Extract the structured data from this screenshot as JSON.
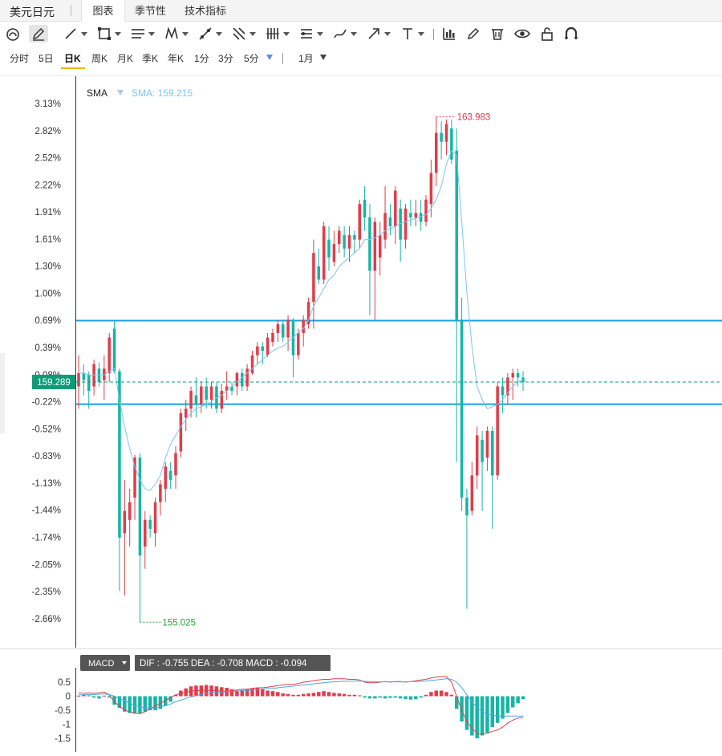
{
  "topbar": {
    "symbol": "美元日元",
    "tabs": [
      {
        "label": "图表",
        "active": true
      },
      {
        "label": "季节性",
        "active": false
      },
      {
        "label": "技术指标",
        "active": false
      }
    ]
  },
  "toolbar": {
    "tools": [
      "magnet-icon",
      "pencil-icon",
      "line-icon",
      "rect-icon",
      "horizontal-lines-icon",
      "pattern-icon",
      "ruler-icon",
      "fork-icon",
      "bars-icon",
      "level-lines-icon",
      "brush-icon",
      "arrow-icon",
      "text-icon",
      "chart-icon",
      "edit-icon",
      "trash-icon",
      "eye-icon",
      "lock-icon",
      "magnet-u-icon"
    ]
  },
  "periods": {
    "items": [
      "分时",
      "5日",
      "日K",
      "周K",
      "月K",
      "季K",
      "年K",
      "1分",
      "3分",
      "5分"
    ],
    "active": "日K",
    "range_label": "1月"
  },
  "main_chart": {
    "indicator_label": "SMA",
    "indicator_value_text": "SMA: 159.215",
    "current_price_text": "159.289",
    "high_label": "163.983",
    "low_label": "155.025",
    "y_ticks": [
      "3.13%",
      "2.82%",
      "2.52%",
      "2.22%",
      "1.91%",
      "1.61%",
      "1.30%",
      "1.00%",
      "0.69%",
      "0.39%",
      "0.08%",
      "-0.22%",
      "-0.52%",
      "-0.83%",
      "-1.13%",
      "-1.44%",
      "-1.74%",
      "-2.05%",
      "-2.35%",
      "-2.66%"
    ],
    "h_line_levels_pct": [
      0.69,
      -0.25
    ],
    "colors": {
      "up": "#e03c4a",
      "down": "#16b5a5",
      "sma": "#7ec5ee",
      "hline": "#1aa3e6",
      "price_badge": "#0f9b78",
      "high": "#e03c4a",
      "low": "#2e9c3e"
    }
  },
  "macd_panel": {
    "selector_label": "MACD",
    "info_text": "DIF : -0.755  DEA : -0.708  MACD : -0.094",
    "y_ticks": [
      "0.5",
      "0",
      "-0.5",
      "-1",
      "-1.5"
    ]
  },
  "chart_data": {
    "type": "candlestick",
    "y_unit": "percent change",
    "ylim": [
      -2.85,
      3.25
    ],
    "candles_pct": [
      [
        -0.05,
        0.1,
        0.3,
        -0.3
      ],
      [
        0.1,
        0.02,
        0.2,
        -0.15
      ],
      [
        0.08,
        -0.1,
        0.12,
        -0.3
      ],
      [
        -0.05,
        0.2,
        0.25,
        -0.15
      ],
      [
        0.15,
        0.0,
        0.22,
        -0.05
      ],
      [
        0.02,
        0.15,
        0.3,
        -0.2
      ],
      [
        0.1,
        0.5,
        0.55,
        0.0
      ],
      [
        0.6,
        0.12,
        0.69,
        0.1
      ],
      [
        0.12,
        -1.75,
        0.15,
        -2.35
      ],
      [
        -1.7,
        -1.45,
        -1.1,
        -2.4
      ],
      [
        -1.55,
        -1.35,
        -1.2,
        -1.85
      ],
      [
        -1.3,
        -0.85,
        -0.82,
        -1.55
      ],
      [
        -0.85,
        -1.95,
        -0.8,
        -2.7
      ],
      [
        -1.85,
        -1.55,
        -1.45,
        -2.1
      ],
      [
        -1.55,
        -1.65,
        -1.5,
        -1.75
      ],
      [
        -1.7,
        -1.35,
        -1.3,
        -1.85
      ],
      [
        -1.35,
        -1.15,
        -1.1,
        -1.5
      ],
      [
        -1.2,
        -0.95,
        -0.9,
        -1.35
      ],
      [
        -1.0,
        -1.1,
        -0.9,
        -1.2
      ],
      [
        -1.05,
        -0.8,
        -0.72,
        -1.2
      ],
      [
        -0.78,
        -0.35,
        -0.3,
        -0.85
      ],
      [
        -0.4,
        -0.3,
        -0.2,
        -0.55
      ],
      [
        -0.3,
        -0.1,
        -0.05,
        -0.4
      ],
      [
        -0.15,
        -0.25,
        0.05,
        -0.4
      ],
      [
        -0.25,
        -0.05,
        0.0,
        -0.35
      ],
      [
        -0.05,
        -0.2,
        0.05,
        -0.3
      ],
      [
        -0.2,
        -0.05,
        0.0,
        -0.3
      ],
      [
        -0.05,
        -0.3,
        0.0,
        -0.35
      ],
      [
        -0.3,
        -0.1,
        -0.02,
        -0.35
      ],
      [
        -0.1,
        -0.05,
        0.12,
        -0.2
      ],
      [
        -0.05,
        -0.1,
        0.0,
        -0.15
      ],
      [
        -0.05,
        0.1,
        0.12,
        -0.15
      ],
      [
        0.1,
        -0.05,
        0.15,
        -0.1
      ],
      [
        -0.05,
        0.15,
        0.2,
        -0.1
      ],
      [
        0.1,
        0.3,
        0.35,
        0.08
      ],
      [
        0.3,
        0.4,
        0.45,
        0.2
      ],
      [
        0.4,
        0.35,
        0.45,
        0.2
      ],
      [
        0.3,
        0.5,
        0.55,
        0.28
      ],
      [
        0.45,
        0.55,
        0.6,
        0.4
      ],
      [
        0.55,
        0.65,
        0.7,
        0.45
      ],
      [
        0.65,
        0.5,
        0.7,
        0.45
      ],
      [
        0.5,
        0.7,
        0.75,
        0.35
      ],
      [
        0.7,
        0.3,
        0.72,
        0.05
      ],
      [
        0.3,
        0.55,
        0.6,
        0.25
      ],
      [
        0.55,
        0.7,
        0.75,
        0.4
      ],
      [
        0.65,
        0.9,
        0.95,
        0.6
      ],
      [
        0.9,
        1.45,
        1.6,
        0.6
      ],
      [
        1.3,
        1.15,
        1.5,
        1.1
      ],
      [
        1.15,
        1.75,
        1.8,
        1.1
      ],
      [
        1.6,
        1.4,
        1.75,
        1.25
      ],
      [
        1.35,
        1.55,
        1.7,
        1.3
      ],
      [
        1.55,
        1.7,
        1.75,
        1.45
      ],
      [
        1.65,
        1.5,
        1.75,
        1.4
      ],
      [
        1.5,
        1.65,
        1.75,
        1.35
      ],
      [
        1.65,
        1.6,
        1.7,
        1.45
      ],
      [
        1.6,
        2.0,
        2.05,
        1.5
      ],
      [
        2.05,
        1.85,
        2.2,
        1.7
      ],
      [
        1.85,
        1.25,
        2.0,
        0.75
      ],
      [
        1.25,
        1.8,
        1.85,
        0.7
      ],
      [
        1.4,
        1.65,
        1.8,
        1.2
      ],
      [
        1.6,
        1.9,
        2.2,
        1.5
      ],
      [
        1.85,
        1.75,
        2.0,
        1.65
      ],
      [
        1.75,
        2.15,
        2.2,
        1.55
      ],
      [
        1.95,
        1.6,
        2.05,
        1.35
      ],
      [
        1.6,
        1.95,
        2.0,
        1.5
      ],
      [
        1.9,
        1.85,
        2.05,
        1.75
      ],
      [
        1.85,
        1.9,
        2.05,
        1.75
      ],
      [
        1.9,
        1.8,
        2.05,
        1.7
      ],
      [
        1.8,
        2.05,
        2.1,
        1.75
      ],
      [
        2.0,
        2.35,
        2.5,
        1.85
      ],
      [
        2.35,
        2.8,
        2.98,
        2.2
      ],
      [
        2.8,
        2.7,
        2.93,
        2.5
      ],
      [
        2.7,
        2.9,
        2.95,
        2.55
      ],
      [
        2.85,
        2.5,
        2.95,
        2.45
      ],
      [
        2.6,
        0.7,
        2.85,
        -0.9
      ],
      [
        0.7,
        -1.3,
        0.95,
        -1.45
      ],
      [
        -1.3,
        -1.5,
        -1.2,
        -2.55
      ],
      [
        -1.45,
        -1.05,
        -0.9,
        -1.5
      ],
      [
        -1.05,
        -0.6,
        -0.5,
        -1.2
      ],
      [
        -0.65,
        -0.9,
        -0.55,
        -1.45
      ],
      [
        -0.85,
        -0.55,
        -0.5,
        -1.0
      ],
      [
        -0.55,
        -1.05,
        -0.5,
        -1.65
      ],
      [
        -1.05,
        -0.05,
        0.0,
        -1.1
      ],
      [
        -0.05,
        -0.15,
        0.05,
        -0.35
      ],
      [
        -0.15,
        0.05,
        0.1,
        -0.25
      ],
      [
        0.05,
        0.1,
        0.15,
        -0.2
      ],
      [
        0.1,
        0.05,
        0.15,
        -0.05
      ],
      [
        0.05,
        0.0,
        0.12,
        -0.1
      ]
    ],
    "sma_pct": [
      0.1,
      0.1,
      0.08,
      0.08,
      0.08,
      0.08,
      0.12,
      0.15,
      -0.2,
      -0.5,
      -0.75,
      -0.95,
      -1.1,
      -1.2,
      -1.22,
      -1.15,
      -1.05,
      -0.85,
      -0.7,
      -0.6,
      -0.5,
      -0.42,
      -0.35,
      -0.3,
      -0.28,
      -0.25,
      -0.22,
      -0.18,
      -0.15,
      -0.1,
      -0.05,
      0.0,
      0.05,
      0.1,
      0.15,
      0.2,
      0.25,
      0.3,
      0.35,
      0.38,
      0.4,
      0.45,
      0.5,
      0.55,
      0.6,
      0.7,
      0.85,
      0.95,
      1.05,
      1.15,
      1.2,
      1.3,
      1.35,
      1.4,
      1.45,
      1.5,
      1.6,
      1.6,
      1.62,
      1.65,
      1.7,
      1.72,
      1.75,
      1.78,
      1.8,
      1.82,
      1.84,
      1.86,
      1.88,
      1.95,
      2.05,
      2.2,
      2.45,
      2.6,
      2.55,
      1.8,
      1.0,
      0.4,
      -0.05,
      -0.2,
      -0.3,
      -0.28,
      -0.25,
      -0.2,
      -0.12,
      -0.05,
      0.0,
      0.02
    ],
    "macd": {
      "dif": [
        0.12,
        0.1,
        0.12,
        0.1,
        0.12,
        0.15,
        0.05,
        -0.2,
        -0.35,
        -0.5,
        -0.55,
        -0.6,
        -0.62,
        -0.55,
        -0.45,
        -0.35,
        -0.25,
        -0.15,
        -0.05,
        0.05,
        0.1,
        0.15,
        0.18,
        0.2,
        0.2,
        0.22,
        0.2,
        0.2,
        0.18,
        0.18,
        0.2,
        0.22,
        0.25,
        0.25,
        0.28,
        0.3,
        0.3,
        0.32,
        0.35,
        0.38,
        0.4,
        0.42,
        0.42,
        0.45,
        0.5,
        0.52,
        0.55,
        0.58,
        0.6,
        0.6,
        0.62,
        0.62,
        0.62,
        0.6,
        0.6,
        0.58,
        0.5,
        0.48,
        0.48,
        0.5,
        0.52,
        0.5,
        0.52,
        0.52,
        0.5,
        0.52,
        0.55,
        0.58,
        0.6,
        0.65,
        0.68,
        0.7,
        0.7,
        0.5,
        0.0,
        -0.5,
        -0.9,
        -1.15,
        -1.3,
        -1.35,
        -1.32,
        -1.25,
        -1.2,
        -1.1,
        -0.95,
        -0.85,
        -0.78,
        -0.755
      ],
      "dea": [
        0.05,
        0.05,
        0.06,
        0.06,
        0.07,
        0.08,
        0.06,
        0.0,
        -0.08,
        -0.16,
        -0.25,
        -0.32,
        -0.38,
        -0.42,
        -0.43,
        -0.41,
        -0.38,
        -0.33,
        -0.28,
        -0.2,
        -0.14,
        -0.08,
        -0.02,
        0.02,
        0.06,
        0.1,
        0.12,
        0.14,
        0.15,
        0.16,
        0.17,
        0.18,
        0.2,
        0.21,
        0.22,
        0.24,
        0.25,
        0.27,
        0.28,
        0.3,
        0.32,
        0.34,
        0.36,
        0.38,
        0.4,
        0.42,
        0.44,
        0.46,
        0.48,
        0.5,
        0.51,
        0.52,
        0.53,
        0.53,
        0.54,
        0.54,
        0.53,
        0.52,
        0.51,
        0.51,
        0.51,
        0.51,
        0.51,
        0.51,
        0.51,
        0.52,
        0.52,
        0.53,
        0.54,
        0.56,
        0.58,
        0.6,
        0.62,
        0.6,
        0.5,
        0.3,
        0.05,
        -0.2,
        -0.4,
        -0.55,
        -0.65,
        -0.68,
        -0.7,
        -0.71,
        -0.71,
        -0.71,
        -0.708,
        -0.708
      ],
      "hist": [
        0.02,
        0.05,
        0.03,
        -0.05,
        -0.08,
        0.02,
        -0.05,
        -0.3,
        -0.42,
        -0.55,
        -0.6,
        -0.62,
        -0.62,
        -0.55,
        -0.5,
        -0.5,
        -0.45,
        -0.35,
        -0.2,
        0.05,
        0.2,
        0.28,
        0.35,
        0.38,
        0.38,
        0.4,
        0.38,
        0.35,
        0.32,
        0.3,
        0.25,
        0.2,
        0.22,
        0.25,
        0.28,
        0.3,
        0.25,
        0.2,
        0.18,
        0.15,
        0.1,
        0.08,
        0.05,
        0.05,
        0.08,
        0.1,
        0.12,
        0.15,
        0.18,
        0.15,
        0.12,
        0.1,
        0.08,
        0.05,
        0.05,
        0.03,
        -0.05,
        -0.08,
        -0.08,
        -0.05,
        -0.08,
        -0.06,
        -0.05,
        -0.08,
        -0.1,
        -0.12,
        -0.1,
        -0.05,
        0.05,
        0.15,
        0.2,
        0.2,
        0.15,
        0.05,
        -0.45,
        -0.9,
        -1.2,
        -1.4,
        -1.5,
        -1.4,
        -1.3,
        -1.1,
        -0.95,
        -0.8,
        -0.6,
        -0.4,
        -0.25,
        -0.1
      ],
      "ylim": [
        -1.6,
        0.75
      ]
    }
  }
}
